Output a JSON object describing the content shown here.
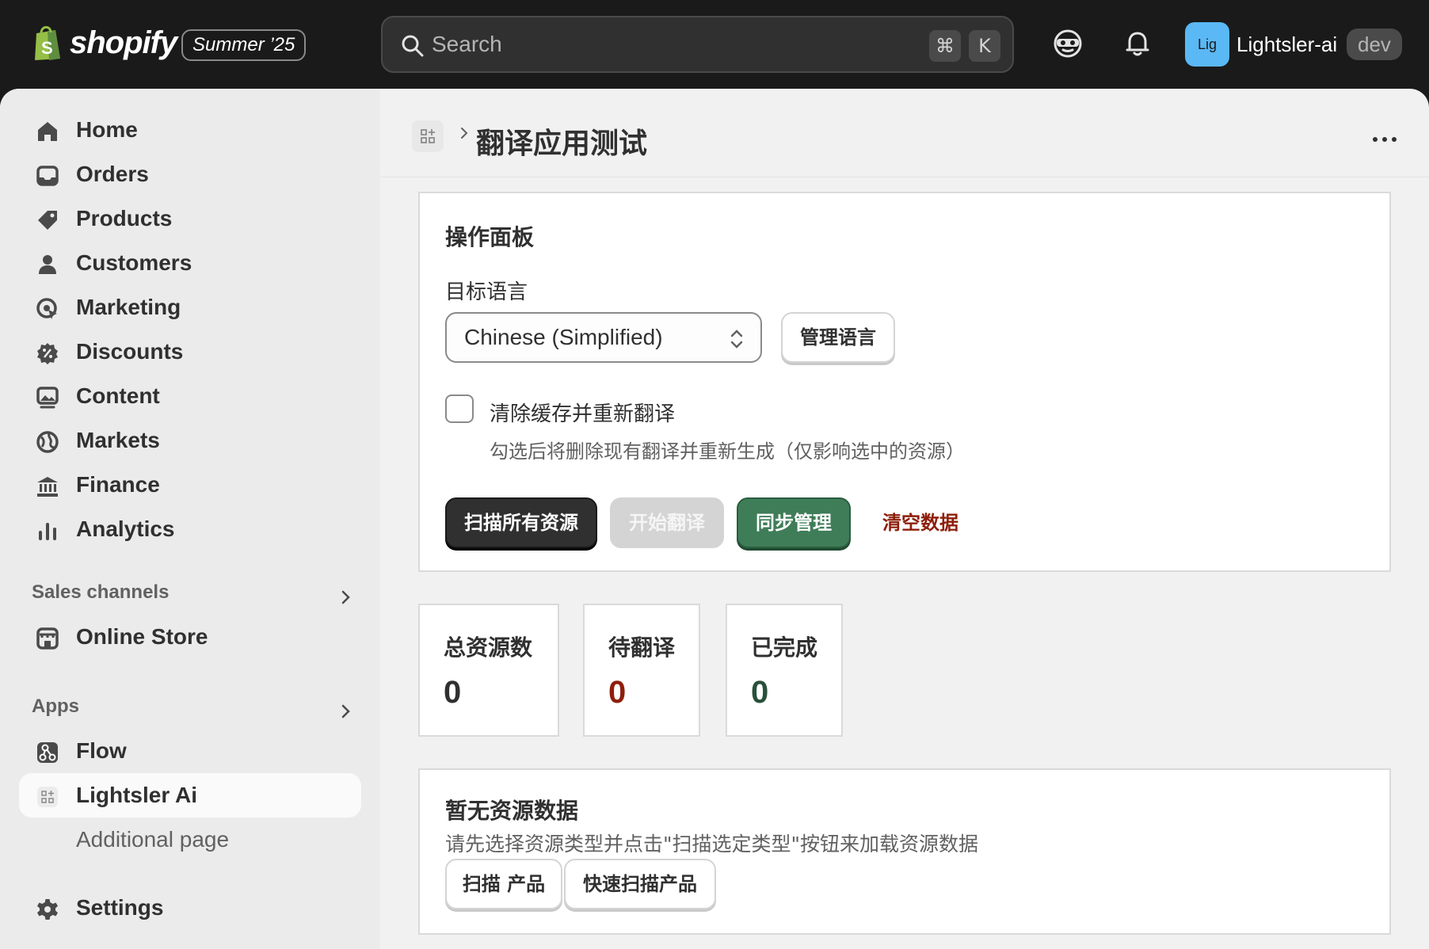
{
  "topbar": {
    "logo_text": "shopify",
    "edition": "Summer ’25",
    "search_placeholder": "Search",
    "shortcut_cmd": "⌘",
    "shortcut_key": "K",
    "store_initials": "Lig",
    "store_name": "Lightsler-ai",
    "store_tag": "dev",
    "icons": [
      "search-icon",
      "sidekick-mask-icon",
      "bell-icon"
    ]
  },
  "sidebar": {
    "items": [
      {
        "label": "Home",
        "icon": "home-icon"
      },
      {
        "label": "Orders",
        "icon": "inbox-icon"
      },
      {
        "label": "Products",
        "icon": "tag-icon"
      },
      {
        "label": "Customers",
        "icon": "person-icon"
      },
      {
        "label": "Marketing",
        "icon": "target-icon"
      },
      {
        "label": "Discounts",
        "icon": "discount-icon"
      },
      {
        "label": "Content",
        "icon": "image-icon"
      },
      {
        "label": "Markets",
        "icon": "globe-icon"
      },
      {
        "label": "Finance",
        "icon": "bank-icon"
      },
      {
        "label": "Analytics",
        "icon": "bar-chart-icon"
      }
    ],
    "sales_channels_title": "Sales channels",
    "online_store": "Online Store",
    "apps_title": "Apps",
    "flow": "Flow",
    "lightsler_ai": "Lightsler Ai",
    "additional_page": "Additional page",
    "settings": "Settings"
  },
  "page": {
    "title": "翻译应用测试"
  },
  "panel": {
    "title": "操作面板",
    "target_language_label": "目标语言",
    "target_language_value": "Chinese (Simplified)",
    "manage_languages": "管理语言",
    "clear_cache_label": "清除缓存并重新翻译",
    "clear_cache_checked": false,
    "clear_cache_help": "勾选后将删除现有翻译并重新生成（仅影响选中的资源）",
    "scan_all": "扫描所有资源",
    "start_translate": "开始翻译",
    "sync_manage": "同步管理",
    "clear_data": "清空数据"
  },
  "stats": [
    {
      "label": "总资源数",
      "value": "0",
      "color": "#303030"
    },
    {
      "label": "待翻译",
      "value": "0",
      "color": "#8e1f0b"
    },
    {
      "label": "已完成",
      "value": "0",
      "color": "#29503a"
    }
  ],
  "empty": {
    "title": "暂无资源数据",
    "description": "请先选择资源类型并点击\"扫描选定类型\"按钮来加载资源数据",
    "scan_products": "扫描 产品",
    "quick_scan_products": "快速扫描产品"
  }
}
